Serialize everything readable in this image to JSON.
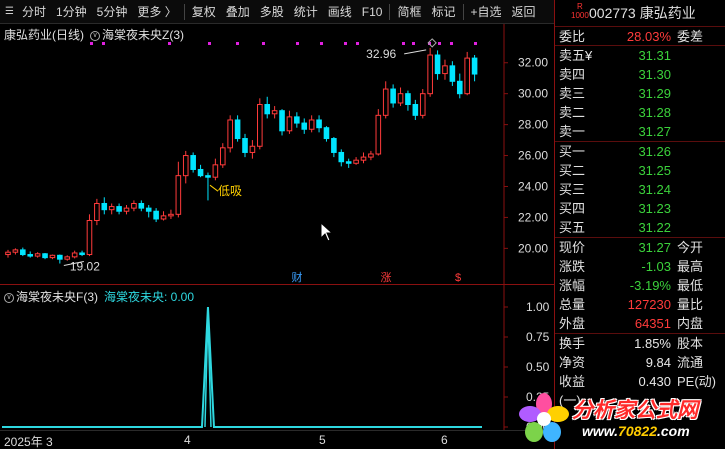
{
  "toolbar": {
    "items": [
      {
        "label": "分时",
        "icon": "menu-icon"
      },
      {
        "label": "1分钟"
      },
      {
        "label": "5分钟"
      },
      {
        "label": "更多 〉"
      },
      {
        "label": "复权"
      },
      {
        "label": "叠加"
      },
      {
        "label": "多股"
      },
      {
        "label": "统计"
      },
      {
        "label": "画线"
      },
      {
        "label": "F10"
      },
      {
        "label": "简框"
      },
      {
        "label": "标记"
      },
      {
        "label": "+自选"
      },
      {
        "label": "返回"
      }
    ]
  },
  "main_chart": {
    "stock_title": "康弘药业(日线)",
    "indicator": "海棠夜未央Z(3)",
    "annotation_high": "32.96",
    "annotation_low": "19.02",
    "annotation_buy": "低吸",
    "markers": [
      {
        "label": "财",
        "color": "#3aa0ff"
      },
      {
        "label": "涨",
        "color": "#ff3b3b"
      },
      {
        "label": "$",
        "color": "#ff3b3b"
      }
    ]
  },
  "sub_chart": {
    "indicator_name": "海棠夜未央F(3)",
    "series_label": "海棠夜未央: 0.00"
  },
  "date_axis": {
    "labels": [
      "2025年 3",
      "4",
      "5",
      "6"
    ]
  },
  "quote": {
    "code": "002773",
    "name": "康弘药业",
    "badge_top": "R",
    "badge_bottom": "1000",
    "weibi_label": "委比",
    "weibi_value": "28.03%",
    "weicha_label": "委差",
    "asks": [
      {
        "label": "卖五",
        "price": "31.31"
      },
      {
        "label": "卖四",
        "price": "31.30"
      },
      {
        "label": "卖三",
        "price": "31.29"
      },
      {
        "label": "卖二",
        "price": "31.28"
      },
      {
        "label": "卖一",
        "price": "31.27"
      }
    ],
    "ask_currency": "¥",
    "bids": [
      {
        "label": "买一",
        "price": "31.26"
      },
      {
        "label": "买二",
        "price": "31.25"
      },
      {
        "label": "买三",
        "price": "31.24"
      },
      {
        "label": "买四",
        "price": "31.23"
      },
      {
        "label": "买五",
        "price": "31.22"
      }
    ],
    "stats": [
      {
        "l1": "现价",
        "v": "31.27",
        "c": "green",
        "l2": "今开"
      },
      {
        "l1": "涨跌",
        "v": "-1.03",
        "c": "green",
        "l2": "最高"
      },
      {
        "l1": "涨幅",
        "v": "-3.19%",
        "c": "green",
        "l2": "最低"
      },
      {
        "l1": "总量",
        "v": "127230",
        "c": "red",
        "l2": "量比"
      },
      {
        "l1": "外盘",
        "v": "64351",
        "c": "red",
        "l2": "内盘"
      }
    ],
    "stats2": [
      {
        "l1": "换手",
        "v": "1.85%",
        "c": "white",
        "l2": "股本"
      },
      {
        "l1": "净资",
        "v": "9.84",
        "c": "white",
        "l2": "流通"
      },
      {
        "l1": "收益(一)",
        "v": "0.430",
        "c": "white",
        "l2": "PE(动)"
      }
    ]
  },
  "watermark": {
    "text": "分析家公式网",
    "url_prefix": "www.",
    "url_main": "70822",
    "url_suffix": ".com"
  },
  "colors": {
    "up": "#ff3b3b",
    "down": "#00e5ff",
    "axis": "#8a1010",
    "magenta": "#e020e0"
  },
  "chart_data": [
    {
      "type": "candlestick",
      "title": "康弘药业(日线)",
      "ylim": [
        18.6,
        33.6
      ],
      "y_ticks": [
        20.0,
        22.0,
        24.0,
        26.0,
        28.0,
        30.0,
        32.0
      ],
      "annotations": [
        {
          "text": "32.96",
          "value": 32.96
        },
        {
          "text": "19.02",
          "value": 19.02
        },
        {
          "text": "低吸",
          "value": 24.6
        }
      ],
      "candles": [
        {
          "o": 19.6,
          "c": 19.75,
          "h": 19.9,
          "l": 19.4
        },
        {
          "o": 19.75,
          "c": 19.9,
          "h": 20.0,
          "l": 19.6
        },
        {
          "o": 19.9,
          "c": 19.6,
          "h": 20.05,
          "l": 19.5
        },
        {
          "o": 19.6,
          "c": 19.5,
          "h": 19.8,
          "l": 19.4
        },
        {
          "o": 19.5,
          "c": 19.65,
          "h": 19.75,
          "l": 19.4
        },
        {
          "o": 19.65,
          "c": 19.4,
          "h": 19.7,
          "l": 19.3
        },
        {
          "o": 19.4,
          "c": 19.55,
          "h": 19.6,
          "l": 19.3
        },
        {
          "o": 19.55,
          "c": 19.3,
          "h": 19.6,
          "l": 19.02
        },
        {
          "o": 19.3,
          "c": 19.45,
          "h": 19.55,
          "l": 19.2
        },
        {
          "o": 19.45,
          "c": 19.7,
          "h": 19.85,
          "l": 19.35
        },
        {
          "o": 19.7,
          "c": 19.6,
          "h": 19.85,
          "l": 19.5
        },
        {
          "o": 19.6,
          "c": 21.8,
          "h": 22.2,
          "l": 19.5
        },
        {
          "o": 21.8,
          "c": 22.9,
          "h": 23.2,
          "l": 21.5
        },
        {
          "o": 22.9,
          "c": 22.5,
          "h": 23.3,
          "l": 22.2
        },
        {
          "o": 22.5,
          "c": 22.7,
          "h": 22.9,
          "l": 22.2
        },
        {
          "o": 22.7,
          "c": 22.4,
          "h": 22.9,
          "l": 22.2
        },
        {
          "o": 22.4,
          "c": 22.6,
          "h": 22.8,
          "l": 22.2
        },
        {
          "o": 22.6,
          "c": 22.9,
          "h": 23.1,
          "l": 22.4
        },
        {
          "o": 22.9,
          "c": 22.6,
          "h": 23.1,
          "l": 22.4
        },
        {
          "o": 22.6,
          "c": 22.4,
          "h": 22.8,
          "l": 22.0
        },
        {
          "o": 22.4,
          "c": 21.9,
          "h": 22.6,
          "l": 21.7
        },
        {
          "o": 21.9,
          "c": 22.1,
          "h": 22.4,
          "l": 21.8
        },
        {
          "o": 22.1,
          "c": 22.2,
          "h": 22.5,
          "l": 21.9
        },
        {
          "o": 22.2,
          "c": 24.7,
          "h": 25.6,
          "l": 22.0
        },
        {
          "o": 24.7,
          "c": 26.0,
          "h": 26.3,
          "l": 24.2
        },
        {
          "o": 26.0,
          "c": 25.1,
          "h": 26.2,
          "l": 24.9
        },
        {
          "o": 25.1,
          "c": 24.7,
          "h": 25.4,
          "l": 24.6
        },
        {
          "o": 24.7,
          "c": 24.6,
          "h": 24.9,
          "l": 23.1
        },
        {
          "o": 24.6,
          "c": 25.4,
          "h": 25.8,
          "l": 24.4
        },
        {
          "o": 25.4,
          "c": 26.5,
          "h": 26.8,
          "l": 25.2
        },
        {
          "o": 26.5,
          "c": 28.3,
          "h": 28.6,
          "l": 26.2
        },
        {
          "o": 28.3,
          "c": 27.1,
          "h": 28.6,
          "l": 26.9
        },
        {
          "o": 27.1,
          "c": 26.2,
          "h": 27.4,
          "l": 25.9
        },
        {
          "o": 26.2,
          "c": 26.6,
          "h": 27.0,
          "l": 25.8
        },
        {
          "o": 26.6,
          "c": 29.3,
          "h": 29.7,
          "l": 26.4
        },
        {
          "o": 29.3,
          "c": 28.7,
          "h": 29.8,
          "l": 28.4
        },
        {
          "o": 28.7,
          "c": 28.9,
          "h": 29.2,
          "l": 28.4
        },
        {
          "o": 28.9,
          "c": 27.6,
          "h": 29.0,
          "l": 27.3
        },
        {
          "o": 27.6,
          "c": 28.5,
          "h": 28.9,
          "l": 27.4
        },
        {
          "o": 28.5,
          "c": 28.1,
          "h": 28.8,
          "l": 27.8
        },
        {
          "o": 28.1,
          "c": 27.7,
          "h": 28.4,
          "l": 27.4
        },
        {
          "o": 27.7,
          "c": 28.3,
          "h": 28.6,
          "l": 27.5
        },
        {
          "o": 28.3,
          "c": 27.8,
          "h": 28.6,
          "l": 27.5
        },
        {
          "o": 27.8,
          "c": 27.1,
          "h": 27.9,
          "l": 26.9
        },
        {
          "o": 27.1,
          "c": 26.2,
          "h": 27.2,
          "l": 25.9
        },
        {
          "o": 26.2,
          "c": 25.6,
          "h": 26.4,
          "l": 25.3
        },
        {
          "o": 25.6,
          "c": 25.5,
          "h": 25.8,
          "l": 25.2
        },
        {
          "o": 25.5,
          "c": 25.7,
          "h": 25.9,
          "l": 25.4
        },
        {
          "o": 25.7,
          "c": 25.9,
          "h": 26.2,
          "l": 25.5
        },
        {
          "o": 25.9,
          "c": 26.1,
          "h": 26.3,
          "l": 25.7
        },
        {
          "o": 26.1,
          "c": 28.6,
          "h": 29.0,
          "l": 26.0
        },
        {
          "o": 28.6,
          "c": 30.3,
          "h": 30.8,
          "l": 28.4
        },
        {
          "o": 30.3,
          "c": 29.4,
          "h": 30.6,
          "l": 29.1
        },
        {
          "o": 29.4,
          "c": 30.0,
          "h": 30.4,
          "l": 29.2
        },
        {
          "o": 30.0,
          "c": 29.3,
          "h": 30.2,
          "l": 28.9
        },
        {
          "o": 29.3,
          "c": 28.6,
          "h": 29.6,
          "l": 28.3
        },
        {
          "o": 28.6,
          "c": 30.0,
          "h": 30.3,
          "l": 28.4
        },
        {
          "o": 30.0,
          "c": 32.5,
          "h": 32.96,
          "l": 29.8
        },
        {
          "o": 32.5,
          "c": 31.3,
          "h": 32.8,
          "l": 30.9
        },
        {
          "o": 31.3,
          "c": 31.8,
          "h": 32.2,
          "l": 30.9
        },
        {
          "o": 31.8,
          "c": 30.8,
          "h": 32.1,
          "l": 30.5
        },
        {
          "o": 30.8,
          "c": 30.0,
          "h": 31.3,
          "l": 29.7
        },
        {
          "o": 30.0,
          "c": 32.3,
          "h": 32.7,
          "l": 29.9
        },
        {
          "o": 32.3,
          "c": 31.27,
          "h": 32.5,
          "l": 30.8
        }
      ]
    },
    {
      "type": "line",
      "title": "海棠夜未央F(3)",
      "ylim": [
        0,
        1.0
      ],
      "y_ticks": [
        0.0,
        0.25,
        0.5,
        0.75,
        1.0
      ],
      "series": [
        {
          "name": "海棠夜未央",
          "signal_index": 27,
          "signal_value": 1.0,
          "baseline": 0.0
        }
      ]
    }
  ]
}
